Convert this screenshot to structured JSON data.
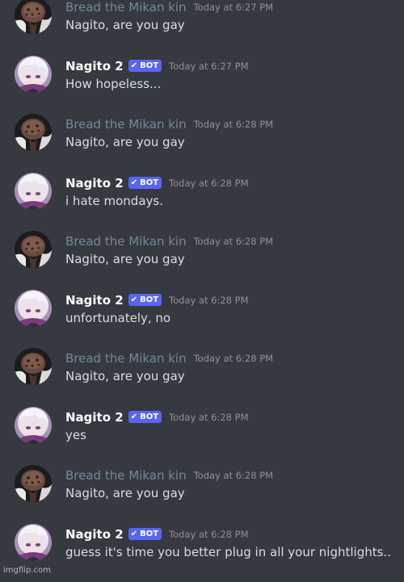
{
  "users": {
    "human": {
      "name": "Bread the Mikan kin",
      "avatar_icon": "bread-avatar-icon"
    },
    "bot": {
      "name": "Nagito 2",
      "badge": "BOT",
      "badge_icon": "checkmark-icon",
      "avatar_icon": "nagito-avatar-icon"
    }
  },
  "messages": [
    {
      "author": "human",
      "time": "Today at 6:27 PM",
      "text": "Nagito, are you gay"
    },
    {
      "author": "bot",
      "time": "Today at 6:27 PM",
      "text": "How hopeless..."
    },
    {
      "author": "human",
      "time": "Today at 6:28 PM",
      "text": "Nagito, are you gay"
    },
    {
      "author": "bot",
      "time": "Today at 6:28 PM",
      "text": "i hate mondays."
    },
    {
      "author": "human",
      "time": "Today at 6:28 PM",
      "text": "Nagito, are you gay"
    },
    {
      "author": "bot",
      "time": "Today at 6:28 PM",
      "text": "unfortunately, no"
    },
    {
      "author": "human",
      "time": "Today at 6:28 PM",
      "text": "Nagito, are you gay"
    },
    {
      "author": "bot",
      "time": "Today at 6:28 PM",
      "text": "yes"
    },
    {
      "author": "human",
      "time": "Today at 6:28 PM",
      "text": "Nagito, are you gay"
    },
    {
      "author": "bot",
      "time": "Today at 6:28 PM",
      "text": "guess it's time you better plug in all your nightlights.."
    }
  ],
  "watermark": "imgflip.com",
  "colors": {
    "background": "#36393f",
    "human_name": "#71899a",
    "bot_name": "#ffffff",
    "badge": "#5865f2",
    "timestamp": "#8e9297",
    "message_text": "#dcddde"
  }
}
